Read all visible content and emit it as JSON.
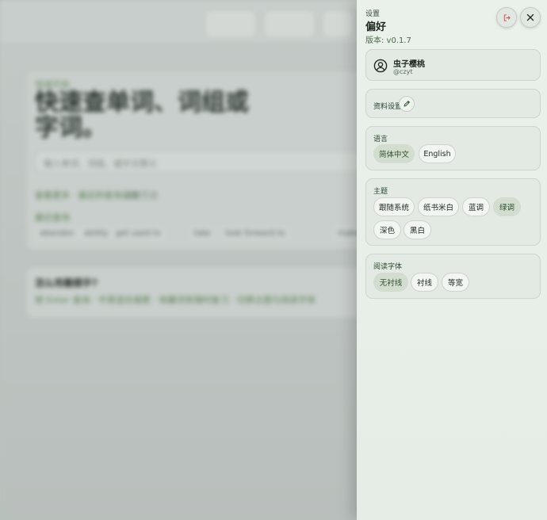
{
  "background": {
    "eyebrow": "快速开始",
    "hero": "快速查单词、词组或字词。",
    "input_placeholder": "输入单词、词组、或中文释义",
    "link_primary": "查看更多 · 最近的查询记录",
    "link_secondary": "清空历史",
    "section_label": "最近查询",
    "chips": [
      "abandon",
      "ability",
      "get used to",
      "take",
      "look forward to",
      "make"
    ],
    "card2_title": "怎么用最顺手?",
    "card2_links": "按 Enter 查询 · 中英混合搜索 · 收藏词条随时复习 · 切换主题与阅读字体"
  },
  "drawer": {
    "eyebrow": "设置",
    "title": "偏好",
    "version": "版本: v0.1.7",
    "user": {
      "name": "虫子樱桃",
      "handle": "@czyt"
    },
    "profile_label": "资料设置",
    "language": {
      "label": "语言",
      "options": [
        "简体中文",
        "English"
      ],
      "selected": "简体中文"
    },
    "theme": {
      "label": "主题",
      "options": [
        "跟随系统",
        "纸书米白",
        "蓝调",
        "绿调",
        "深色",
        "黑白"
      ],
      "selected": "绿调"
    },
    "font": {
      "label": "阅读字体",
      "options": [
        "无衬线",
        "衬线",
        "等宽"
      ],
      "selected": "无衬线"
    }
  },
  "colors": {
    "accent": "#4d6a47",
    "active_chip_bg": "#d2ddcf",
    "drawer_bg": "#e8eee8",
    "logout_icon": "#d9534f"
  },
  "icons": {
    "logout": "logout-icon",
    "close": "close-icon",
    "avatar": "user-circle-icon",
    "edit": "pencil-icon"
  }
}
